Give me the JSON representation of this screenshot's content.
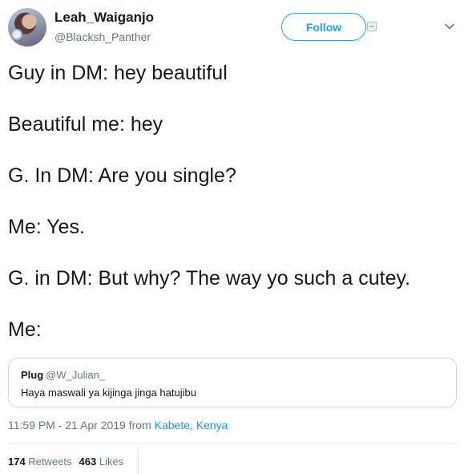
{
  "user": {
    "display_name": "Leah_Waiganjo",
    "handle": "@Blacksh_Panther"
  },
  "actions": {
    "follow_label": "Follow"
  },
  "tweet": {
    "lines": [
      "Guy in DM: hey beautiful",
      "Beautiful me: hey",
      "G. In DM: Are you single?",
      "Me: Yes.",
      "G. in DM: But why? The way yo such a cutey.",
      "Me:"
    ]
  },
  "quoted_tweet": {
    "author": "Plug",
    "handle": "@W_Julian_",
    "text": "Haya maswali ya kijinga jinga hatujibu"
  },
  "meta": {
    "timestamp": "11:59 PM - 21 Apr 2019",
    "from_label": "from",
    "location": "Kabete, Kenya"
  },
  "stats": {
    "retweets_count": "174",
    "retweets_label": "Retweets",
    "likes_count": "463",
    "likes_label": "Likes"
  },
  "colors": {
    "accent": "#1da1f2",
    "link": "#1b95e0",
    "secondary_text": "#657786",
    "border": "#ccd6dd"
  },
  "icons": [
    "avatar",
    "follow-extra-icon",
    "chevron-down-icon"
  ]
}
